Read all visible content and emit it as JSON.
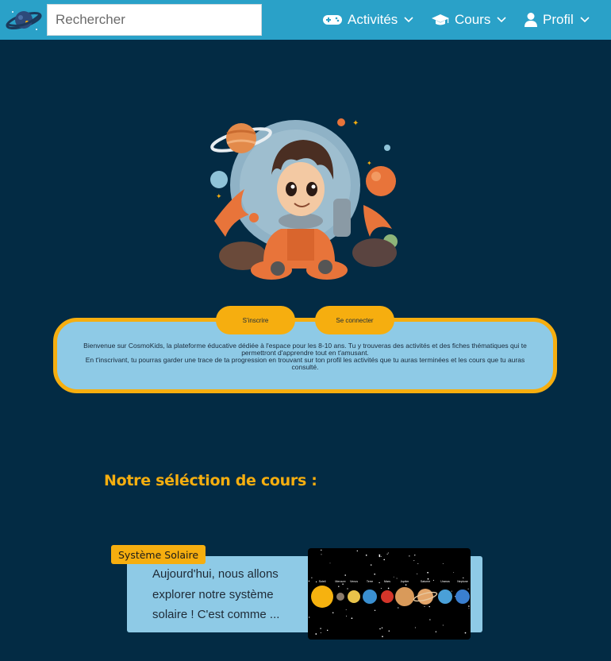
{
  "navbar": {
    "search_placeholder": "Rechercher",
    "items": [
      {
        "label": "Activités",
        "icon": "gamepad-icon"
      },
      {
        "label": "Cours",
        "icon": "graduation-cap-icon"
      },
      {
        "label": "Profil",
        "icon": "user-icon"
      }
    ],
    "colors": {
      "bar": "#2aa1c8",
      "text": "#ffffff"
    }
  },
  "auth": {
    "signup_label": "S'inscrire",
    "login_label": "Se connecter"
  },
  "welcome": {
    "line1": "Bienvenue sur CosmoKids, la plateforme éducative dédiée à l'espace pour les 8-10 ans. Tu y trouveras des activités et des fiches thématiques qui te permettront d'apprendre tout en t'amusant.",
    "line2": "En t'inscrivant, tu pourras garder une trace de ta progression en trouvant sur ton profil les activités que tu auras terminées et les cours que tu auras consulté."
  },
  "section": {
    "title": "Notre séléction de cours :"
  },
  "courses": [
    {
      "tag": "Système Solaire",
      "excerpt": "Aujourd'hui, nous allons explorer notre système solaire ! C'est comme ...",
      "image_labels": [
        "Soleil",
        "Mercure",
        "Venus",
        "Terre",
        "Mars",
        "Jupiter",
        "Saturne",
        "Uranus",
        "Neptune"
      ]
    }
  ],
  "colors": {
    "background": "#032b44",
    "accent": "#f6ae0f",
    "card": "#8ecae6"
  }
}
